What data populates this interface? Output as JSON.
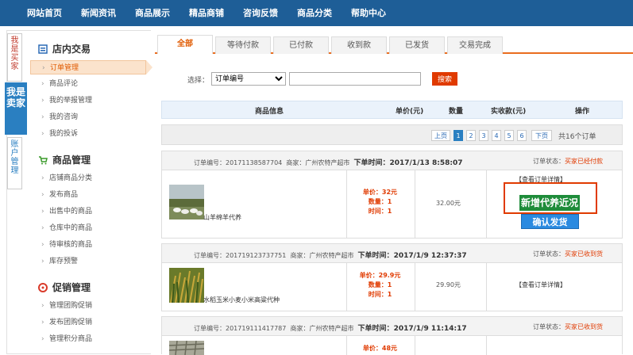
{
  "topnav": {
    "items": [
      "网站首页",
      "新闻资讯",
      "商品展示",
      "精品商铺",
      "咨询反馈",
      "商品分类",
      "帮助中心"
    ]
  },
  "vtabs": {
    "buyer": "我是买家",
    "seller": "我是卖家",
    "account": "账户管理"
  },
  "sidebar": {
    "sections": [
      {
        "title": "店内交易",
        "items": [
          "订单管理",
          "商品评论",
          "我的举报管理",
          "我的咨询",
          "我的投诉"
        ]
      },
      {
        "title": "商品管理",
        "items": [
          "店铺商品分类",
          "发布商品",
          "出售中的商品",
          "仓库中的商品",
          "待审核的商品",
          "库存预警"
        ]
      },
      {
        "title": "促销管理",
        "items": [
          "管理团购促销",
          "发布团购促销",
          "管理积分商品"
        ]
      }
    ]
  },
  "tabs": [
    "全部",
    "等待付款",
    "已付款",
    "收到款",
    "已发货",
    "交易完成"
  ],
  "search": {
    "label": "选择：",
    "select_value": "订单编号",
    "button": "搜索"
  },
  "table_header": {
    "product": "商品信息",
    "price": "单价(元)",
    "qty": "数量",
    "amount": "实收款(元)",
    "action": "操作"
  },
  "pager": {
    "prev": "上页",
    "pages": [
      "1",
      "2",
      "3",
      "4",
      "5",
      "6"
    ],
    "next": "下页",
    "total": "共16个订单"
  },
  "orders": [
    {
      "meta_no_label": "订单编号：",
      "no": "20171138587704",
      "merchant_label": "商家：",
      "merchant": "广州农特产超市",
      "time_label": "下单时间：",
      "time": "2017/1/13 8:58:07",
      "status_label": "订单状态：",
      "status": "买家已经付款",
      "name": "山羊绵羊代养",
      "price_label": "单价：",
      "price": "32元",
      "qty_label": "数量：",
      "qty": "1",
      "dur_label": "时间：",
      "dur": "1",
      "total": "32.00元",
      "detail": "【查看订单详情】",
      "special": "新增代养近况",
      "ship": "确认发货"
    },
    {
      "meta_no_label": "订单编号：",
      "no": "201719123737751",
      "merchant_label": "商家：",
      "merchant": "广州农特产超市",
      "time_label": "下单时间：",
      "time": "2017/1/9 12:37:37",
      "status_label": "订单状态：",
      "status": "买家已收到货",
      "name": "水稻玉米小麦小米高粱代种",
      "price_label": "单价：",
      "price": "29.9元",
      "qty_label": "数量：",
      "qty": "1",
      "dur_label": "时间：",
      "dur": "1",
      "total": "29.90元",
      "detail": "【查看订单详情】"
    },
    {
      "meta_no_label": "订单编号：",
      "no": "201719111417787",
      "merchant_label": "商家：",
      "merchant": "广州农特产超市",
      "time_label": "下单时间：",
      "time": "2017/1/9 11:14:17",
      "status_label": "订单状态：",
      "status": "买家已收到货",
      "price_label": "单价：",
      "price": "48元"
    }
  ],
  "colors": {
    "nav": "#1e5e97",
    "accent": "#e03a00",
    "seller_tab": "#2a7fc1",
    "green": "#1e8c3a"
  }
}
